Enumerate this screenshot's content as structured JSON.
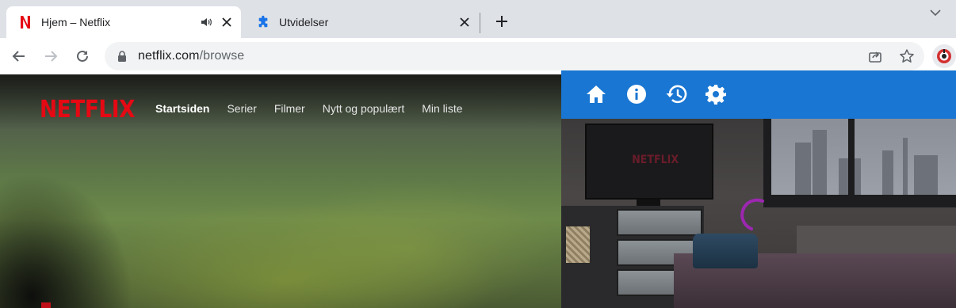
{
  "browser": {
    "tabs": [
      {
        "title": "Hjem – Netflix",
        "favicon": "netflix-n-icon",
        "active": true,
        "audio": true
      },
      {
        "title": "Utvidelser",
        "favicon": "puzzle-extension-icon",
        "active": false,
        "audio": false
      }
    ],
    "address_bar": {
      "domain": "netflix.com",
      "path": "/browse"
    }
  },
  "netflix": {
    "logo": "NETFLIX",
    "nav": [
      "Startsiden",
      "Serier",
      "Filmer",
      "Nytt og populært",
      "Min liste"
    ],
    "active_nav": "Startsiden",
    "tv_logo": "NETFLIX"
  },
  "extension_popup": {
    "toolbar_icons": [
      "home-icon",
      "info-icon",
      "history-icon",
      "settings-icon"
    ],
    "accent_color": "#1976d2",
    "loading": true
  },
  "colors": {
    "netflix_red": "#e50914",
    "chrome_tabstrip": "#dee1e6",
    "spinner": "#9c27b0"
  }
}
